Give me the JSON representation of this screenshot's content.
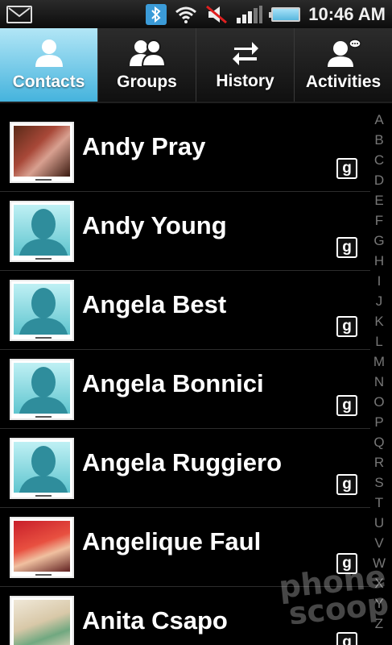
{
  "status_bar": {
    "time": "10:46 AM",
    "icons": [
      "mail-icon",
      "bluetooth-icon",
      "wifi-icon",
      "muted-speaker-icon",
      "signal-icon",
      "battery-icon"
    ]
  },
  "tabs": [
    {
      "label": "Contacts",
      "icon": "person-icon",
      "active": true
    },
    {
      "label": "Groups",
      "icon": "people-icon",
      "active": false
    },
    {
      "label": "History",
      "icon": "arrows-icon",
      "active": false
    },
    {
      "label": "Activities",
      "icon": "person-speech-icon",
      "active": false
    }
  ],
  "contacts": [
    {
      "name": "Andy Pray",
      "photo": true,
      "badge": "g"
    },
    {
      "name": "Andy Young",
      "photo": false,
      "badge": "g"
    },
    {
      "name": "Angela Best",
      "photo": false,
      "badge": "g"
    },
    {
      "name": "Angela Bonnici",
      "photo": false,
      "badge": "g"
    },
    {
      "name": "Angela Ruggiero",
      "photo": false,
      "badge": "g"
    },
    {
      "name": "Angelique Faul",
      "photo": true,
      "badge": "g"
    },
    {
      "name": "Anita Csapo",
      "photo": true,
      "badge": "g"
    }
  ],
  "index_letters": [
    "A",
    "B",
    "C",
    "D",
    "E",
    "F",
    "G",
    "H",
    "I",
    "J",
    "K",
    "L",
    "M",
    "N",
    "O",
    "P",
    "Q",
    "R",
    "S",
    "T",
    "U",
    "V",
    "W",
    "X",
    "Y",
    "Z"
  ],
  "watermark": {
    "line1": "phone",
    "line2": "scoop"
  },
  "colors": {
    "accent": "#45b3dd",
    "background": "#000000"
  }
}
